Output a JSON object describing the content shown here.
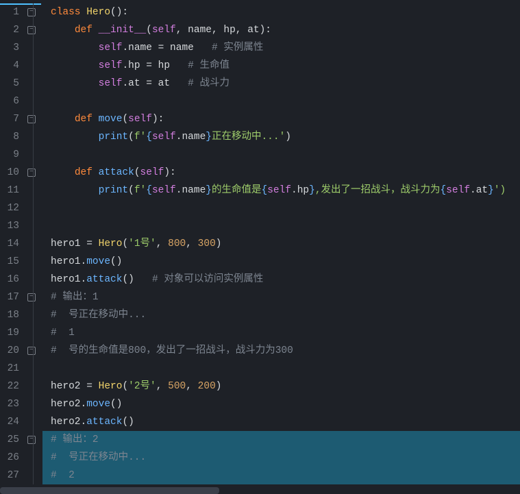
{
  "totalLines": 27,
  "foldMarkers": [
    1,
    2,
    7,
    10,
    17,
    20,
    25
  ],
  "selection": [
    25,
    26,
    27
  ],
  "lines": {
    "1": [
      {
        "t": "class ",
        "c": "kw"
      },
      {
        "t": "Hero",
        "c": "cls"
      },
      {
        "t": "():",
        "c": "pun"
      }
    ],
    "2": [
      {
        "t": "    ",
        "c": ""
      },
      {
        "t": "def ",
        "c": "kw"
      },
      {
        "t": "__init__",
        "c": "magic"
      },
      {
        "t": "(",
        "c": "pun"
      },
      {
        "t": "self",
        "c": "self"
      },
      {
        "t": ", ",
        "c": "pun"
      },
      {
        "t": "name",
        "c": "attr"
      },
      {
        "t": ", ",
        "c": "pun"
      },
      {
        "t": "hp",
        "c": "attr"
      },
      {
        "t": ", ",
        "c": "pun"
      },
      {
        "t": "at",
        "c": "attr"
      },
      {
        "t": "):",
        "c": "pun"
      }
    ],
    "3": [
      {
        "t": "        ",
        "c": ""
      },
      {
        "t": "self",
        "c": "self"
      },
      {
        "t": ".name = name   ",
        "c": "attr"
      },
      {
        "t": "# 实例属性",
        "c": "cmt"
      }
    ],
    "4": [
      {
        "t": "        ",
        "c": ""
      },
      {
        "t": "self",
        "c": "self"
      },
      {
        "t": ".hp = hp   ",
        "c": "attr"
      },
      {
        "t": "# 生命值",
        "c": "cmt"
      }
    ],
    "5": [
      {
        "t": "        ",
        "c": ""
      },
      {
        "t": "self",
        "c": "self"
      },
      {
        "t": ".at = at   ",
        "c": "attr"
      },
      {
        "t": "# 战斗力",
        "c": "cmt"
      }
    ],
    "6": [],
    "7": [
      {
        "t": "    ",
        "c": ""
      },
      {
        "t": "def ",
        "c": "kw"
      },
      {
        "t": "move",
        "c": "fn"
      },
      {
        "t": "(",
        "c": "pun"
      },
      {
        "t": "self",
        "c": "self"
      },
      {
        "t": "):",
        "c": "pun"
      }
    ],
    "8": [
      {
        "t": "        ",
        "c": ""
      },
      {
        "t": "print",
        "c": "pr"
      },
      {
        "t": "(",
        "c": "pun"
      },
      {
        "t": "f'",
        "c": "str"
      },
      {
        "t": "{",
        "c": "brace"
      },
      {
        "t": "self",
        "c": "self"
      },
      {
        "t": ".name",
        "c": "attr"
      },
      {
        "t": "}",
        "c": "brace"
      },
      {
        "t": "正在移动中...'",
        "c": "str"
      },
      {
        "t": ")",
        "c": "pun"
      }
    ],
    "9": [],
    "10": [
      {
        "t": "    ",
        "c": ""
      },
      {
        "t": "def ",
        "c": "kw"
      },
      {
        "t": "attack",
        "c": "fn"
      },
      {
        "t": "(",
        "c": "pun"
      },
      {
        "t": "self",
        "c": "self"
      },
      {
        "t": "):",
        "c": "pun"
      }
    ],
    "11": [
      {
        "t": "        ",
        "c": ""
      },
      {
        "t": "print",
        "c": "pr"
      },
      {
        "t": "(",
        "c": "pun"
      },
      {
        "t": "f'",
        "c": "str"
      },
      {
        "t": "{",
        "c": "brace"
      },
      {
        "t": "self",
        "c": "self"
      },
      {
        "t": ".name",
        "c": "attr"
      },
      {
        "t": "}",
        "c": "brace"
      },
      {
        "t": "的生命值是",
        "c": "str"
      },
      {
        "t": "{",
        "c": "brace"
      },
      {
        "t": "self",
        "c": "self"
      },
      {
        "t": ".hp",
        "c": "attr"
      },
      {
        "t": "}",
        "c": "brace"
      },
      {
        "t": ",发出了一招战斗，战斗力为",
        "c": "str"
      },
      {
        "t": "{",
        "c": "brace"
      },
      {
        "t": "self",
        "c": "self"
      },
      {
        "t": ".at",
        "c": "attr"
      },
      {
        "t": "}",
        "c": "brace"
      },
      {
        "t": "')",
        "c": "str"
      }
    ],
    "12": [],
    "13": [],
    "14": [
      {
        "t": "hero1 = ",
        "c": "var"
      },
      {
        "t": "Hero",
        "c": "cls"
      },
      {
        "t": "(",
        "c": "pun"
      },
      {
        "t": "'1号'",
        "c": "str"
      },
      {
        "t": ", ",
        "c": "pun"
      },
      {
        "t": "800",
        "c": "num2"
      },
      {
        "t": ", ",
        "c": "pun"
      },
      {
        "t": "300",
        "c": "num2"
      },
      {
        "t": ")",
        "c": "pun"
      }
    ],
    "15": [
      {
        "t": "hero1.",
        "c": "var"
      },
      {
        "t": "move",
        "c": "fn"
      },
      {
        "t": "()",
        "c": "pun"
      }
    ],
    "16": [
      {
        "t": "hero1.",
        "c": "var"
      },
      {
        "t": "attack",
        "c": "fn"
      },
      {
        "t": "()   ",
        "c": "pun"
      },
      {
        "t": "# 对象可以访问实例属性",
        "c": "cmt"
      }
    ],
    "17": [
      {
        "t": "# 输出：1",
        "c": "cmt"
      }
    ],
    "18": [
      {
        "t": "#  号正在移动中...",
        "c": "cmt"
      }
    ],
    "19": [
      {
        "t": "#  1",
        "c": "cmt"
      }
    ],
    "20": [
      {
        "t": "#  号的生命值是800，发出了一招战斗，战斗力为300",
        "c": "cmt"
      }
    ],
    "21": [],
    "22": [
      {
        "t": "hero2 = ",
        "c": "var"
      },
      {
        "t": "Hero",
        "c": "cls"
      },
      {
        "t": "(",
        "c": "pun"
      },
      {
        "t": "'2号'",
        "c": "str"
      },
      {
        "t": ", ",
        "c": "pun"
      },
      {
        "t": "500",
        "c": "num2"
      },
      {
        "t": ", ",
        "c": "pun"
      },
      {
        "t": "200",
        "c": "num2"
      },
      {
        "t": ")",
        "c": "pun"
      }
    ],
    "23": [
      {
        "t": "hero2.",
        "c": "var"
      },
      {
        "t": "move",
        "c": "fn"
      },
      {
        "t": "()",
        "c": "pun"
      }
    ],
    "24": [
      {
        "t": "hero2.",
        "c": "var"
      },
      {
        "t": "attack",
        "c": "fn"
      },
      {
        "t": "()",
        "c": "pun"
      }
    ],
    "25": [
      {
        "t": "# 输出：2",
        "c": "cmt"
      }
    ],
    "26": [
      {
        "t": "#  号正在移动中...",
        "c": "cmt"
      }
    ],
    "27": [
      {
        "t": "#  2",
        "c": "cmt"
      }
    ]
  }
}
